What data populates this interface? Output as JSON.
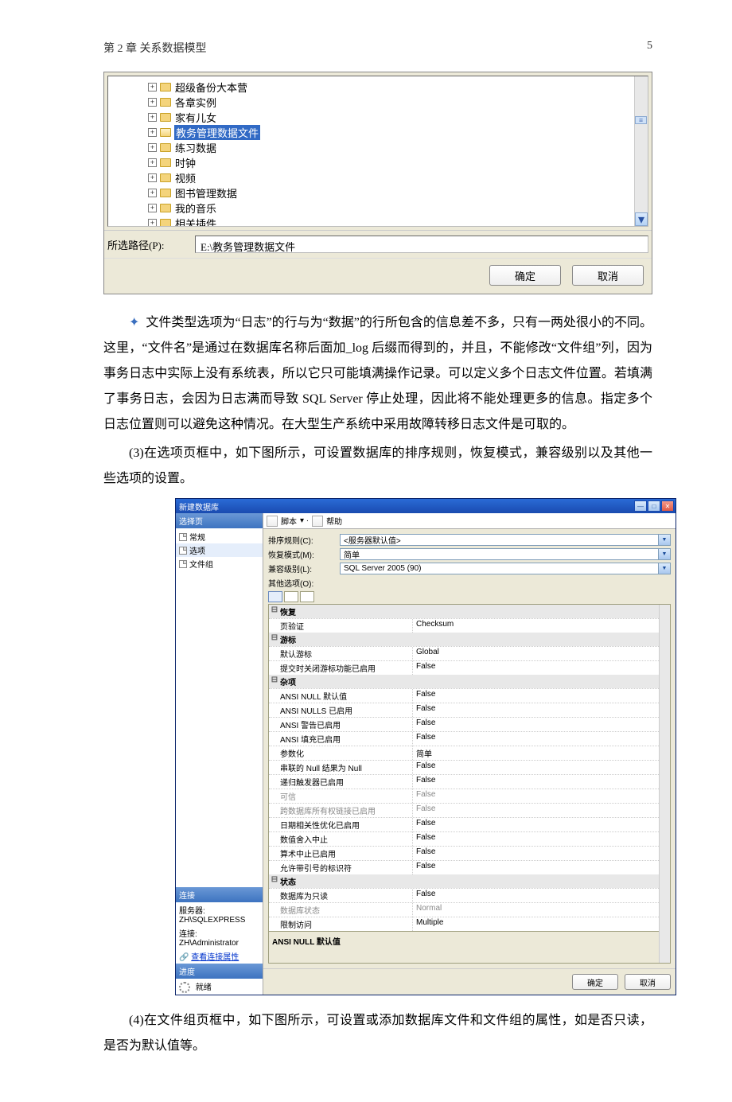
{
  "header": {
    "chapter": "第 2 章  关系数据模型",
    "page_num": "5"
  },
  "scr1": {
    "tree": [
      {
        "label": "超级备份大本营",
        "selected": false
      },
      {
        "label": "各章实例",
        "selected": false
      },
      {
        "label": "家有儿女",
        "selected": false
      },
      {
        "label": "教务管理数据文件",
        "selected": true
      },
      {
        "label": "练习数据",
        "selected": false
      },
      {
        "label": "时钟",
        "selected": false
      },
      {
        "label": "视频",
        "selected": false
      },
      {
        "label": "图书管理数据",
        "selected": false
      },
      {
        "label": "我的音乐",
        "selected": false
      },
      {
        "label": "相关插件",
        "selected": false
      }
    ],
    "path_label": "所选路径(P):",
    "path_value": "E:\\教务管理数据文件",
    "ok": "确定",
    "cancel": "取消"
  },
  "para1": "文件类型选项为“日志”的行与为“数据”的行所包含的信息差不多，只有一两处很小的不同。这里，“文件名”是通过在数据库名称后面加_log 后缀而得到的，并且，不能修改“文件组”列，因为事务日志中实际上没有系统表，所以它只可能填满操作记录。可以定义多个日志文件位置。若填满了事务日志，会因为日志满而导致 SQL Server 停止处理，因此将不能处理更多的信息。指定多个日志位置则可以避免这种情况。在大型生产系统中采用故障转移日志文件是可取的。",
  "para2": "(3)在选项页框中，如下图所示，可设置数据库的排序规则，恢复模式，兼容级别以及其他一些选项的设置。",
  "scr2": {
    "title": "新建数据库",
    "left": {
      "header1": "选择页",
      "items": [
        "常规",
        "选项",
        "文件组"
      ],
      "selected_index": 1,
      "header2": "连接",
      "server_lbl": "服务器:",
      "server_val": "ZH\\SQLEXPRESS",
      "conn_lbl": "连接:",
      "conn_val": "ZH\\Administrator",
      "link": "查看连接属性",
      "header3": "进度",
      "ready": "就绪"
    },
    "toolbar": {
      "script": "脚本",
      "help": "帮助"
    },
    "form": {
      "collation_l": "排序规则(C):",
      "collation_v": "<服务器默认值>",
      "recovery_l": "恢复模式(M):",
      "recovery_v": "简单",
      "compat_l": "兼容级别(L):",
      "compat_v": "SQL Server 2005 (90)",
      "other_l": "其他选项(O):"
    },
    "grid": {
      "cats": [
        {
          "name": "恢复",
          "rows": [
            {
              "k": "页验证",
              "v": "Checksum"
            }
          ]
        },
        {
          "name": "游标",
          "rows": [
            {
              "k": "默认游标",
              "v": "Global"
            },
            {
              "k": "提交时关闭游标功能已启用",
              "v": "False"
            }
          ]
        },
        {
          "name": "杂项",
          "rows": [
            {
              "k": "ANSI NULL 默认值",
              "v": "False"
            },
            {
              "k": "ANSI NULLS 已启用",
              "v": "False"
            },
            {
              "k": "ANSI 警告已启用",
              "v": "False"
            },
            {
              "k": "ANSI 填充已启用",
              "v": "False"
            },
            {
              "k": "参数化",
              "v": "简单"
            },
            {
              "k": "串联的 Null 结果为 Null",
              "v": "False"
            },
            {
              "k": "递归触发器已启用",
              "v": "False"
            },
            {
              "k": "可信",
              "v": "False",
              "ro": true
            },
            {
              "k": "跨数据库所有权链接已启用",
              "v": "False",
              "ro": true
            },
            {
              "k": "日期相关性优化已启用",
              "v": "False"
            },
            {
              "k": "数值舍入中止",
              "v": "False"
            },
            {
              "k": "算术中止已启用",
              "v": "False"
            },
            {
              "k": "允许带引号的标识符",
              "v": "False"
            }
          ]
        },
        {
          "name": "状态",
          "rows": [
            {
              "k": "数据库为只读",
              "v": "False"
            },
            {
              "k": "数据库状态",
              "v": "Normal",
              "ro": true
            },
            {
              "k": "限制访问",
              "v": "Multiple"
            }
          ]
        }
      ],
      "desc": "ANSI NULL 默认值"
    },
    "ok": "确定",
    "cancel": "取消"
  },
  "para3": "(4)在文件组页框中，如下图所示，可设置或添加数据库文件和文件组的属性，如是否只读，是否为默认值等。"
}
